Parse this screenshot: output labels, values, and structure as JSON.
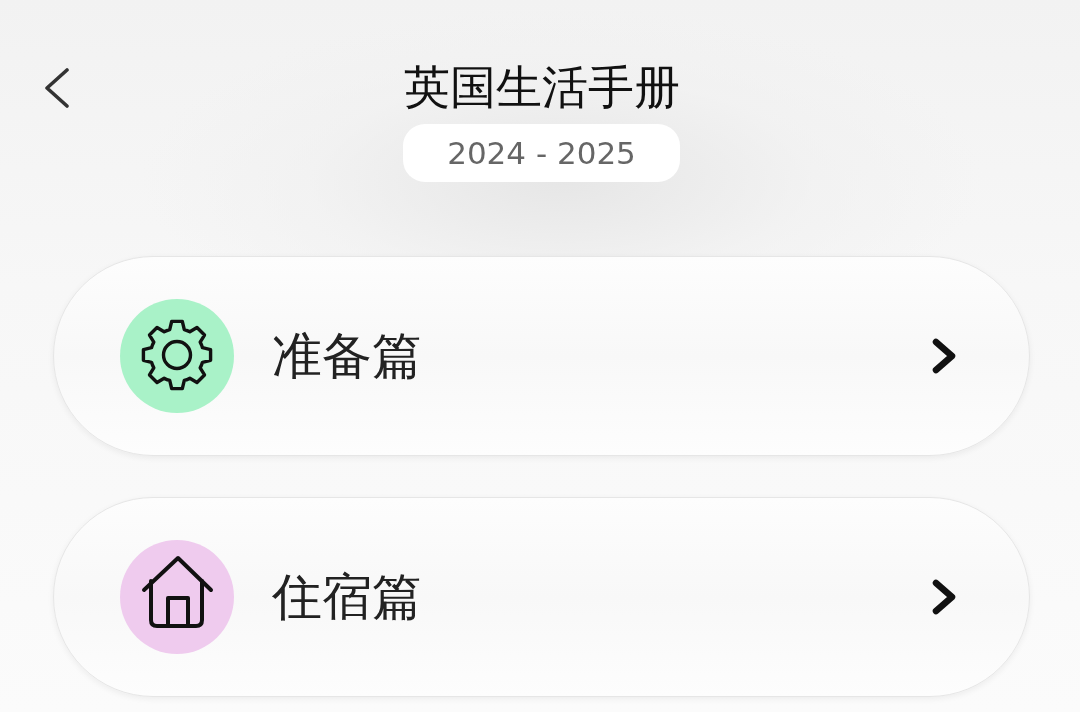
{
  "header": {
    "title": "英国生活手册",
    "year_range": "2024 - 2025"
  },
  "sections": [
    {
      "label": "准备篇",
      "kind": "gear",
      "color": "#a9f2c8"
    },
    {
      "label": "住宿篇",
      "kind": "house",
      "color": "#efcbee"
    }
  ]
}
